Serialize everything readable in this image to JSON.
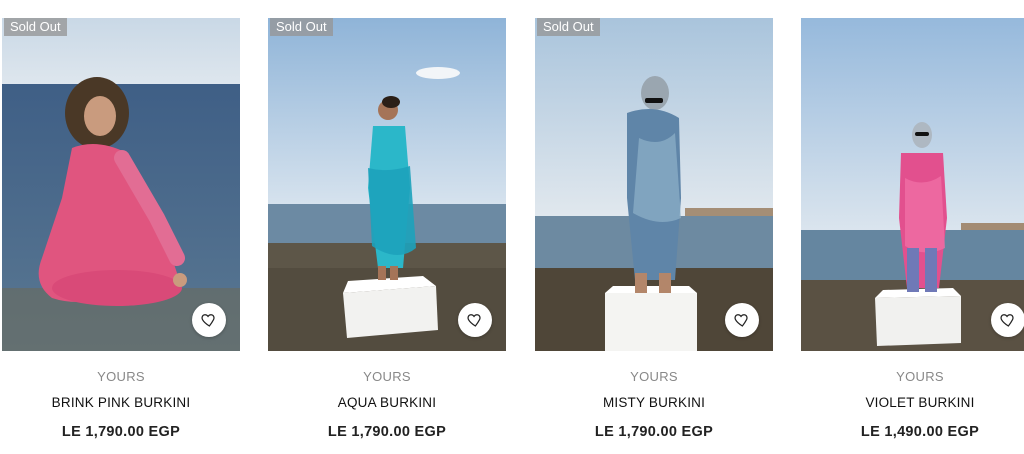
{
  "colors": {
    "badge_bg": "#9a9a9a",
    "text_muted": "#888888",
    "text_main": "#111111"
  },
  "products": [
    {
      "badge": "Sold Out",
      "brand": "YOURS",
      "name": "BRINK PINK BURKINI",
      "price": "LE 1,790.00 EGP",
      "wishlist_icon": "heart-icon"
    },
    {
      "badge": "Sold Out",
      "brand": "YOURS",
      "name": "AQUA BURKINI",
      "price": "LE 1,790.00 EGP",
      "wishlist_icon": "heart-icon"
    },
    {
      "badge": "Sold Out",
      "brand": "YOURS",
      "name": "MISTY BURKINI",
      "price": "LE 1,790.00 EGP",
      "wishlist_icon": "heart-icon"
    },
    {
      "badge": "",
      "brand": "YOURS",
      "name": "VIOLET BURKINI",
      "price": "LE 1,490.00 EGP",
      "wishlist_icon": "heart-icon"
    }
  ]
}
